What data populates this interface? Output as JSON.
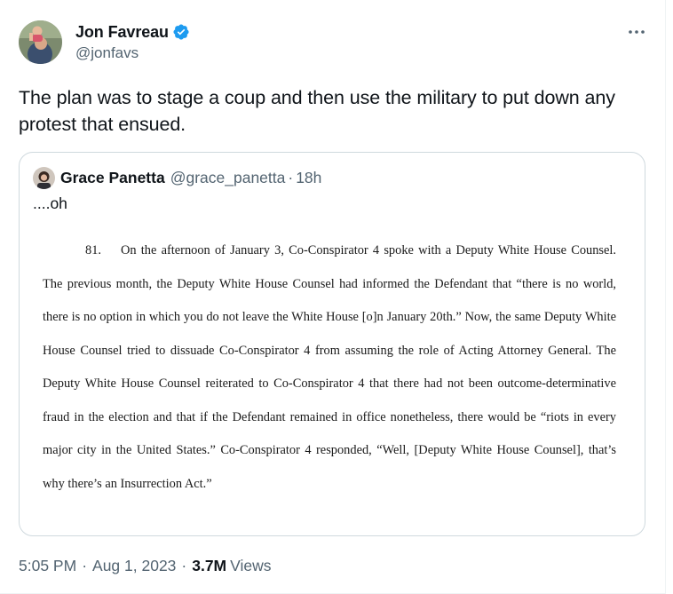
{
  "author": {
    "name": "Jon Favreau",
    "handle": "@jonfavs",
    "verified_color": "#1d9bf0"
  },
  "more_icon": "more-horizontal-icon",
  "tweet": {
    "text": "The plan was to stage a coup and then use the military to put down any protest that ensued."
  },
  "quote": {
    "name": "Grace Panetta",
    "handle": "@grace_panetta",
    "separator": "·",
    "time": "18h",
    "text": "....oh",
    "document": {
      "paragraph_number": "81.",
      "body": "On the afternoon of January 3, Co-Conspirator 4 spoke with a Deputy White House Counsel.  The previous month, the Deputy White House Counsel had informed the Defendant that “there is no world, there is no option in which you do not leave the White House [o]n January 20th.”  Now, the same Deputy White House Counsel tried to dissuade Co-Conspirator 4 from assuming the role of Acting Attorney General.  The Deputy White House Counsel reiterated to Co-Conspirator 4 that there had not been outcome-determinative fraud in the election and that if the Defendant remained in office nonetheless, there would be “riots in every major city in the United States.”  Co-Conspirator 4 responded, “Well, [Deputy White House Counsel], that’s why there’s an Insurrection Act.”"
    }
  },
  "meta": {
    "time": "5:05 PM",
    "separator": "·",
    "date": "Aug 1, 2023",
    "views_count": "3.7M",
    "views_label": "Views"
  }
}
